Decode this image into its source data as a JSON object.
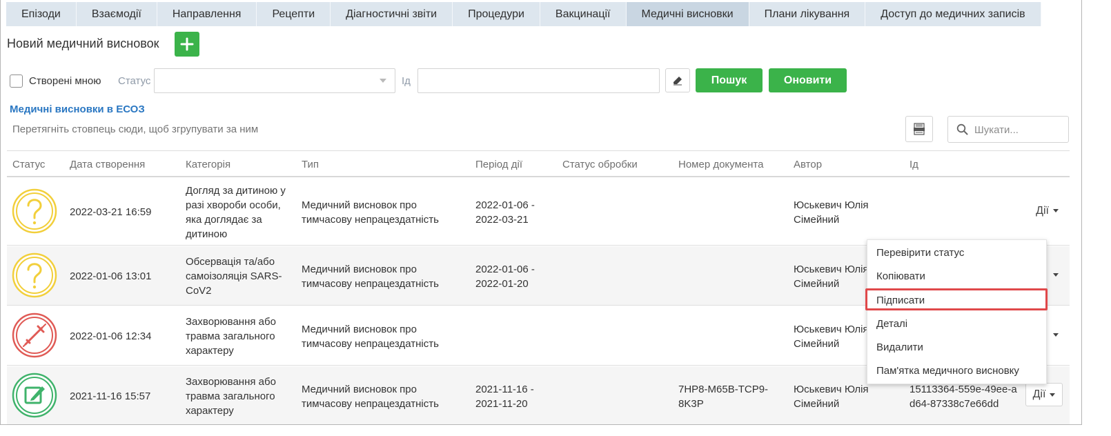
{
  "tabs": [
    {
      "label": "Епізоди"
    },
    {
      "label": "Взаємодії"
    },
    {
      "label": "Направлення"
    },
    {
      "label": "Рецепти"
    },
    {
      "label": "Діагностичні звіти"
    },
    {
      "label": "Процедури"
    },
    {
      "label": "Вакцинації"
    },
    {
      "label": "Медичні висновки",
      "active": true
    },
    {
      "label": "Плани лікування"
    },
    {
      "label": "Доступ до медичних записів"
    }
  ],
  "new_report": {
    "title": "Новий медичний висновок"
  },
  "filters": {
    "created_by_me": "Створені мною",
    "status_label": "Статус",
    "id_label": "Ід",
    "search_button": "Пошук",
    "refresh_button": "Оновити"
  },
  "section": {
    "title": "Медичні висновки в ЕСОЗ",
    "group_hint": "Перетягніть стовпець сюди, щоб згрупувати за ним",
    "search_placeholder": "Шукати..."
  },
  "columns": [
    "Статус",
    "Дата створення",
    "Категорія",
    "Тип",
    "Період дії",
    "Статус обробки",
    "Номер документа",
    "Автор",
    "Ід"
  ],
  "rows": [
    {
      "status_icon": "question-icon",
      "created": "2022-03-21 16:59",
      "category": "Догляд за дитиною у разі хвороби особи, яка доглядає за дитиною",
      "type": "Медичний висновок про тимчасову непрацездатність",
      "period": "2022-01-06 - 2022-03-21",
      "processing_status": "",
      "doc_number": "",
      "author": "Юськевич Юлія Сімейний",
      "id": "",
      "actions": "Дії"
    },
    {
      "status_icon": "question-icon",
      "created": "2022-01-06 13:01",
      "category": "Обсервація та/або самоізоляція SARS-CoV2",
      "type": "Медичний висновок про тимчасову непрацездатність",
      "period": "2022-01-06 - 2022-01-20",
      "processing_status": "",
      "doc_number": "",
      "author": "Юськевич Юлія Сімейний",
      "id": "",
      "actions": ""
    },
    {
      "status_icon": "cancelled-pen-icon",
      "created": "2022-01-06 12:34",
      "category": "Захворювання або травма загального характеру",
      "type": "Медичний висновок про тимчасову непрацездатність",
      "period": "",
      "processing_status": "",
      "doc_number": "",
      "author": "Юськевич Юлія Сімейний",
      "id": "",
      "actions": ""
    },
    {
      "status_icon": "signed-edit-icon",
      "created": "2021-11-16 15:57",
      "category": "Захворювання або травма загального характеру",
      "type": "Медичний висновок про тимчасову непрацездатність",
      "period": "2021-11-16 - 2021-11-20",
      "processing_status": "",
      "doc_number": "7HP8-M65B-TCP9-8K3P",
      "author": "Юськевич Юлія Сімейний",
      "id": "15113364-559e-49ee-ad64-87338c7e66dd",
      "actions": "Дії"
    }
  ],
  "context_menu": {
    "items": [
      "Перевірити статус",
      "Копіювати",
      "Підписати",
      "Деталі",
      "Видалити",
      "Пам'ятка медичного висновку"
    ],
    "highlighted": "Підписати"
  },
  "colors": {
    "accent_green": "#3bb34a",
    "link_blue": "#2a77c2",
    "tab_bg": "#dde6ee",
    "tab_active": "#c9d6e2",
    "highlight_red": "#e0484a",
    "icon_yellow": "#f2cf3b",
    "icon_red": "#e05a55",
    "icon_green": "#3fb36b"
  }
}
